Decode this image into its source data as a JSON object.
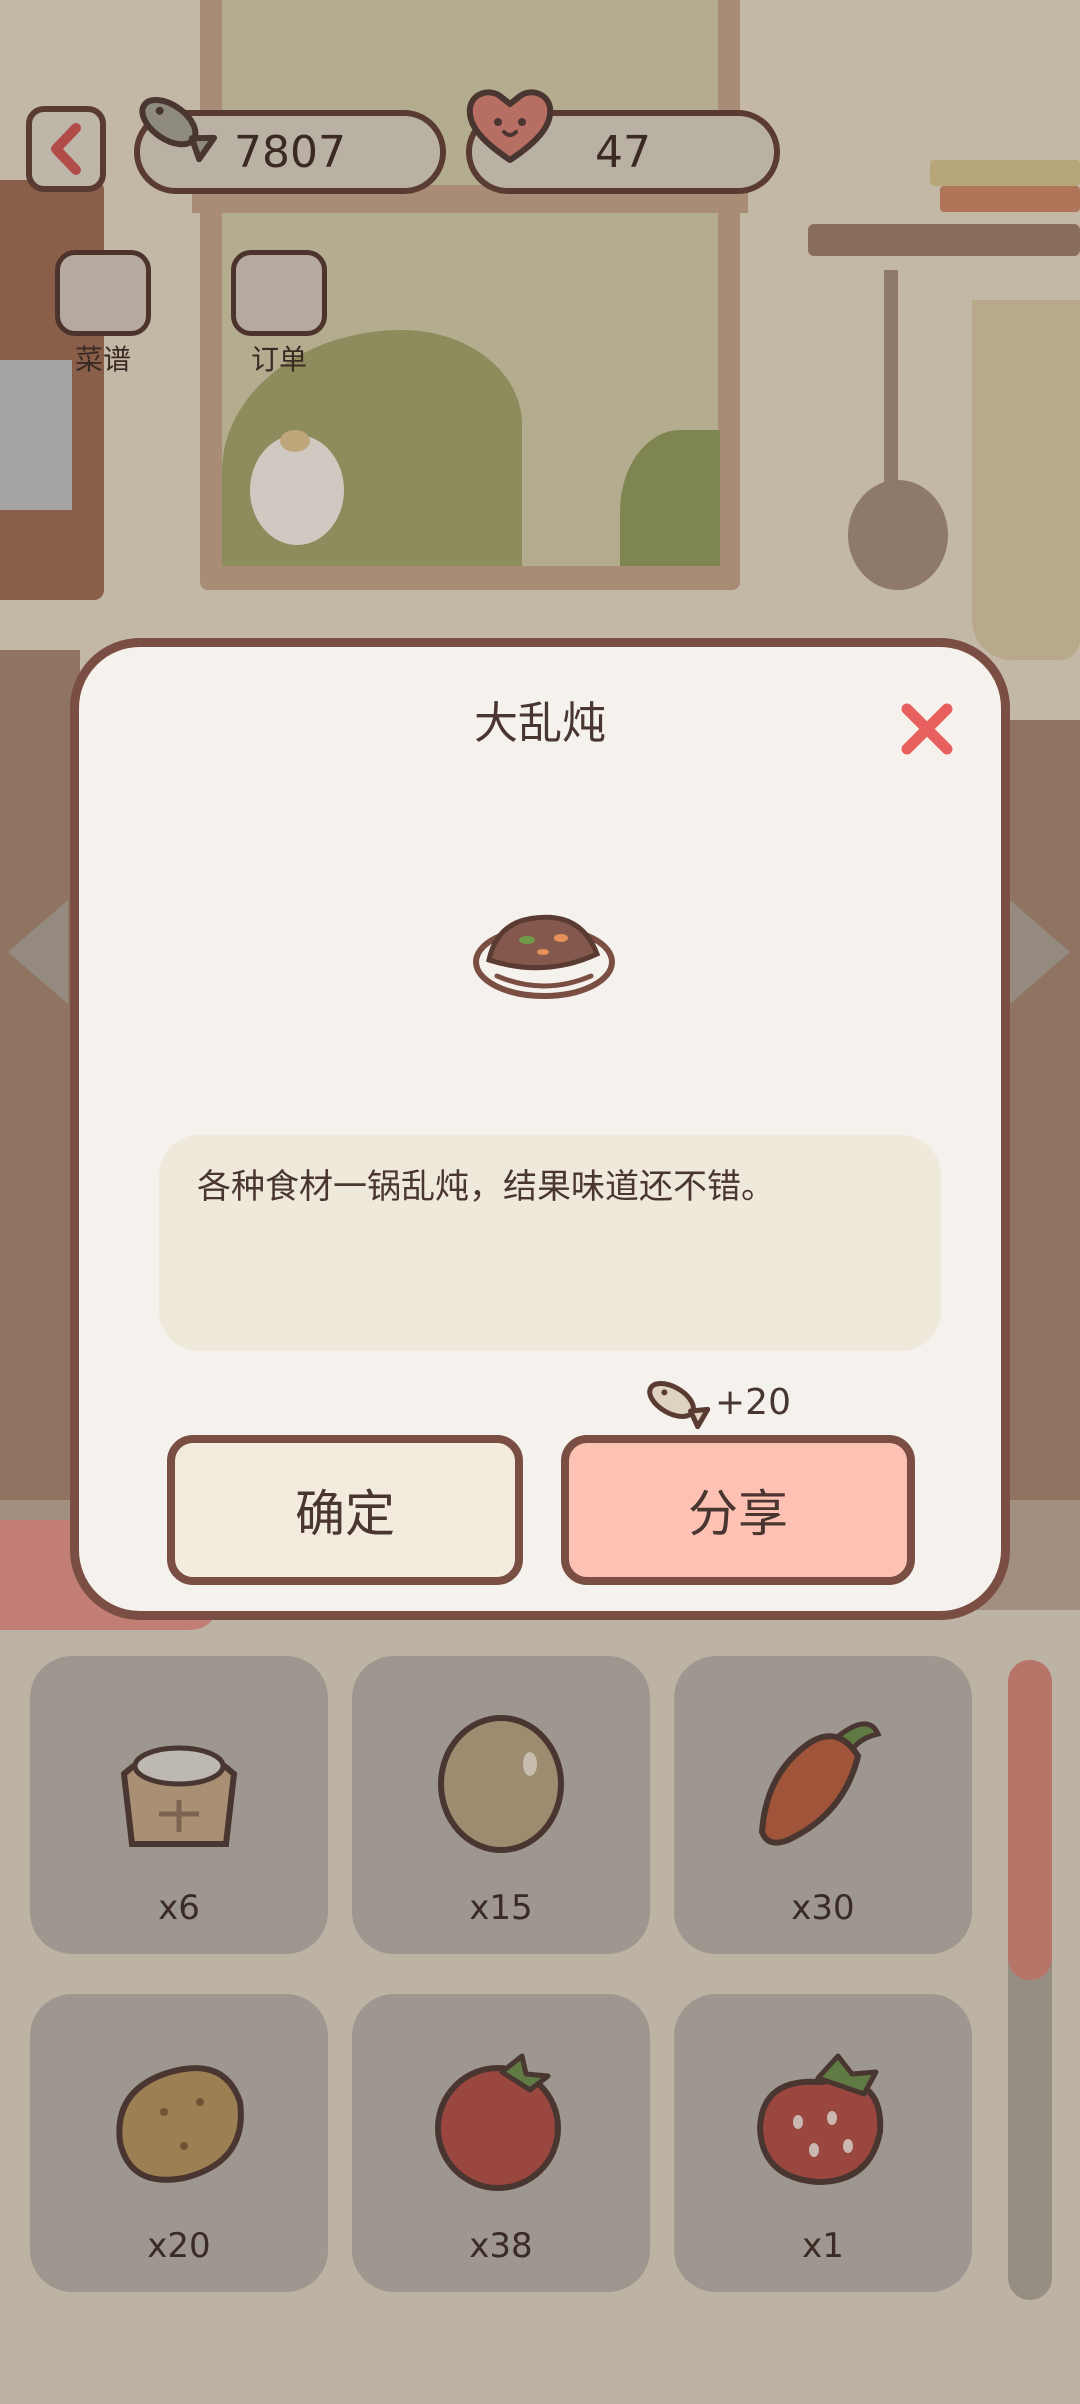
{
  "hud": {
    "fish_count": "7807",
    "heart_count": "47",
    "nav": [
      {
        "label": "菜谱"
      },
      {
        "label": "订单"
      }
    ]
  },
  "dialog": {
    "title": "大乱炖",
    "description": "各种食材一锅乱炖，结果味道还不错。",
    "reward": "+20",
    "confirm_label": "确定",
    "share_label": "分享"
  },
  "ingredients": [
    {
      "icon": "flour-sack-icon",
      "count": "x6"
    },
    {
      "icon": "egg-icon",
      "count": "x15"
    },
    {
      "icon": "carrot-icon",
      "count": "x30"
    },
    {
      "icon": "potato-icon",
      "count": "x20"
    },
    {
      "icon": "tomato-icon",
      "count": "x38"
    },
    {
      "icon": "strawberry-icon",
      "count": "x1"
    }
  ],
  "colors": {
    "dialog_border": "#7a4e43",
    "share_button": "#fec2b5",
    "close_x": "#e8605e",
    "background_dim": "#8f8980"
  }
}
